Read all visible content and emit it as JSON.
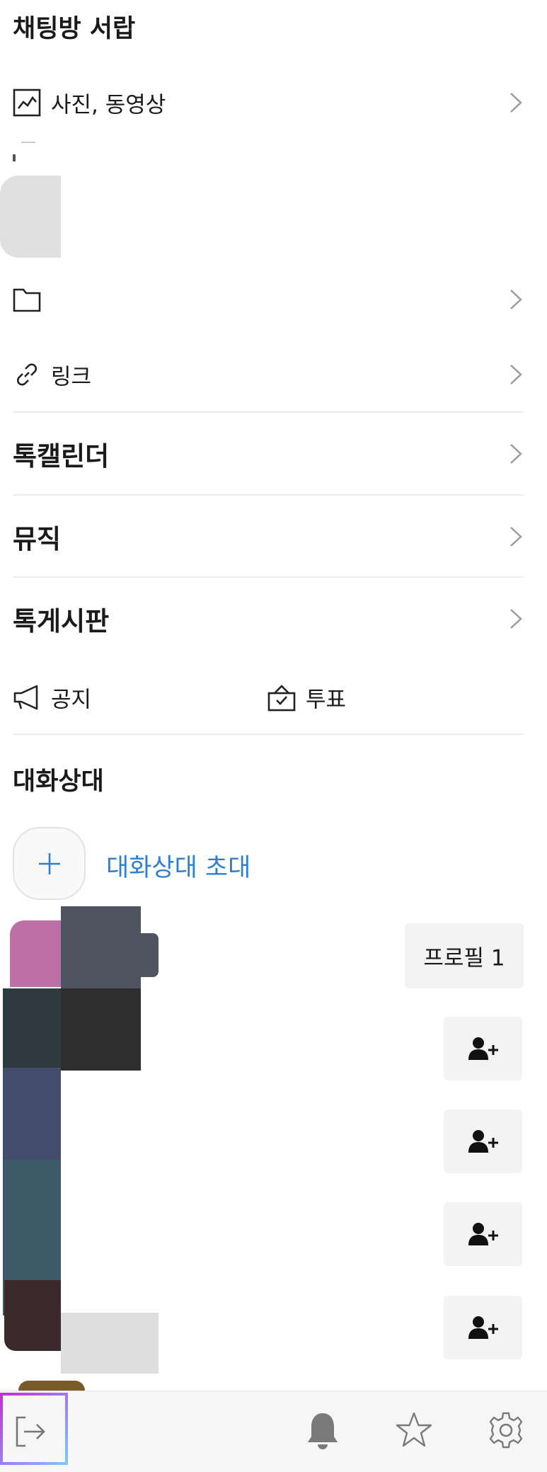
{
  "drawer": {
    "title": "채팅방 서랍",
    "media_label": "사진, 동영상",
    "file_label": "",
    "link_label": "링크"
  },
  "menu": {
    "talk_calendar": "톡캘린더",
    "music": "뮤직",
    "talk_board": "톡게시판"
  },
  "actions": {
    "notice": "공지",
    "vote": "투표"
  },
  "members": {
    "title": "대화상대",
    "invite_label": "대화상대 초대",
    "profile_button": "프로필 1"
  },
  "icons": {
    "media": "image-icon",
    "file": "folder-icon",
    "link": "link-icon",
    "notice": "megaphone-icon",
    "vote": "ballot-box-icon",
    "add_friend": "add-user-icon",
    "exit": "exit-icon",
    "bell": "bell-icon",
    "favorite": "star-icon",
    "settings": "gear-icon"
  },
  "colors": {
    "accent_blue": "#2e7fcf",
    "text": "#1a1a1a",
    "divider": "#ececec",
    "button_bg": "#f3f3f3"
  }
}
